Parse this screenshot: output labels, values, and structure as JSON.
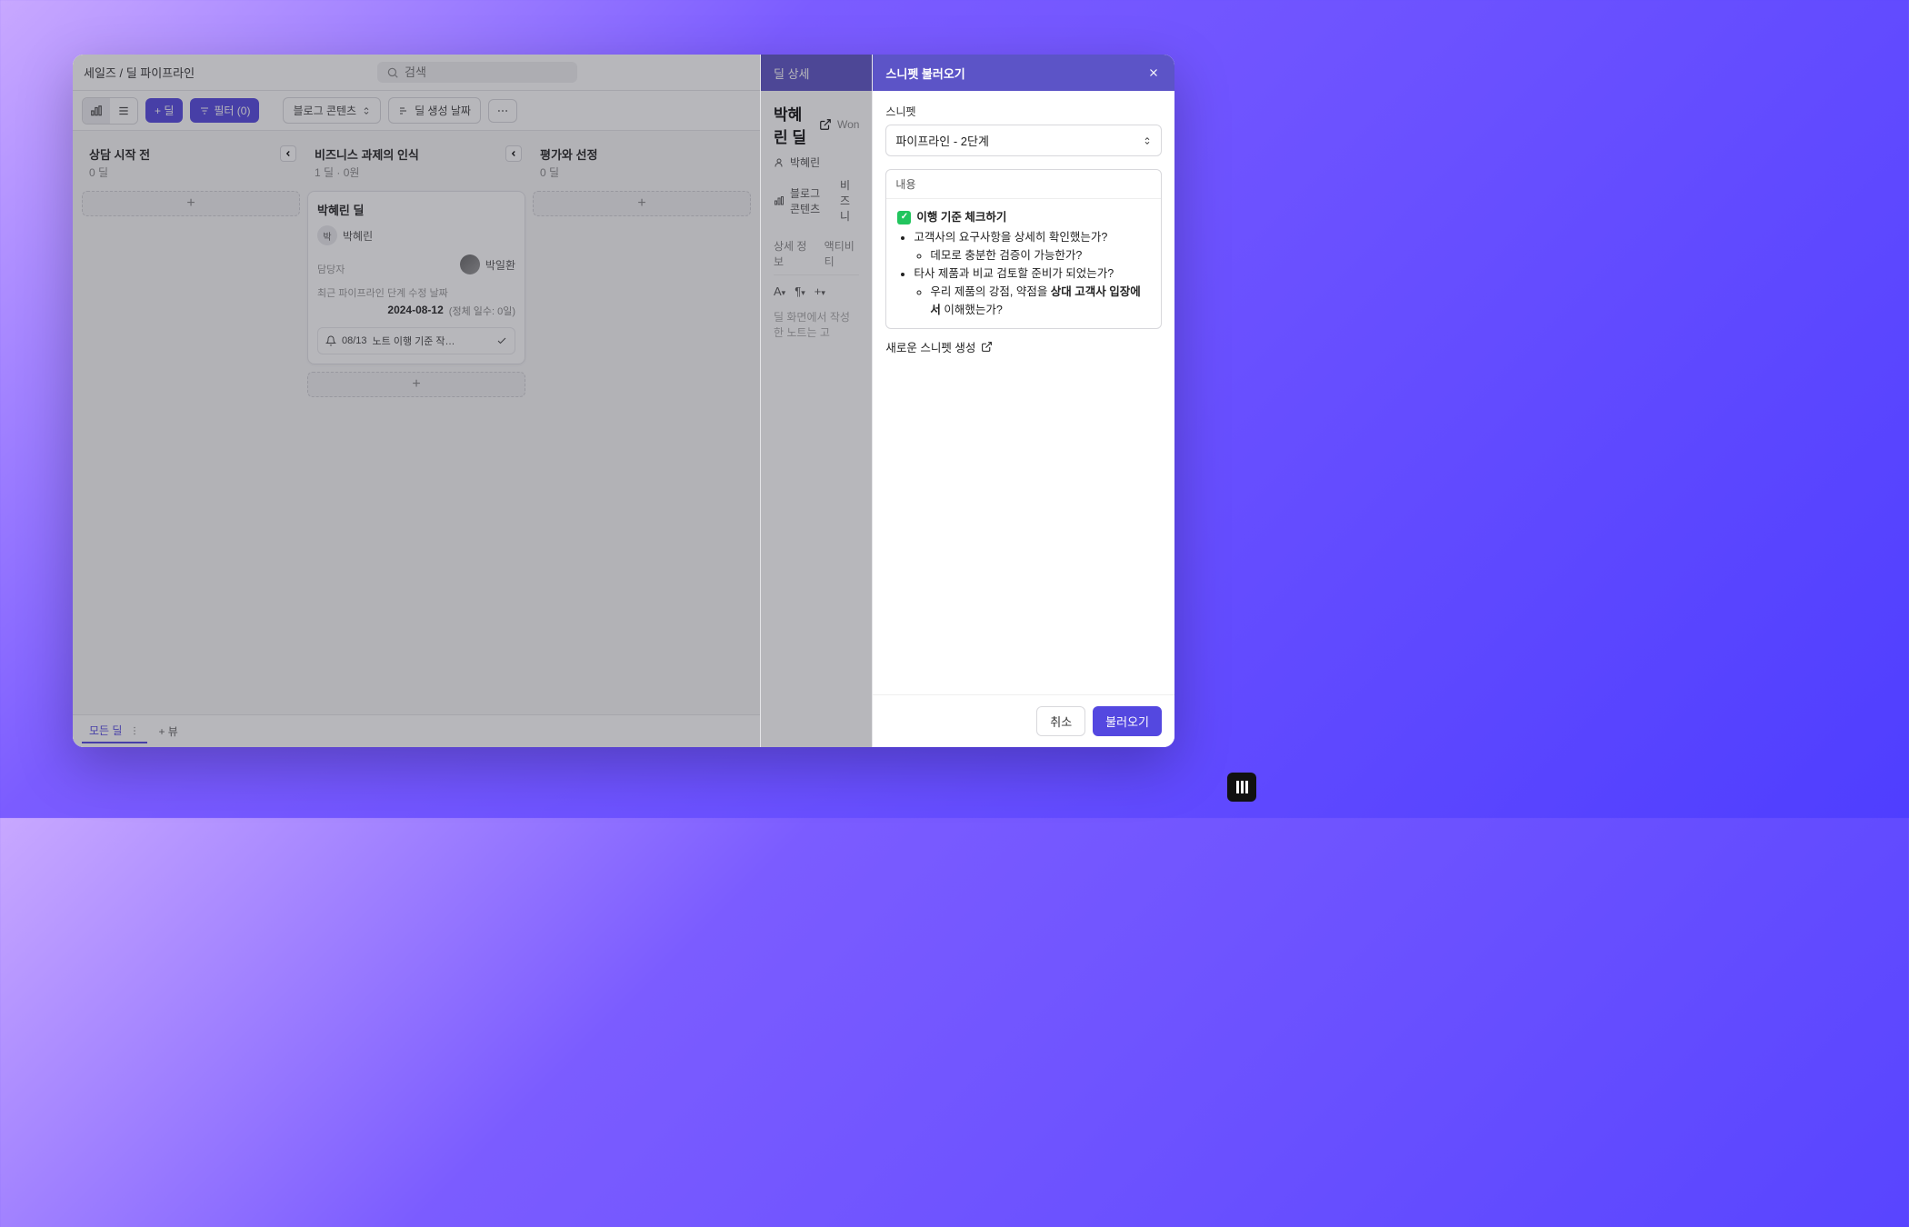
{
  "breadcrumb": "세일즈 / 딜 파이프라인",
  "search": {
    "placeholder": "검색"
  },
  "toolbar": {
    "add_deal": "+ 딜",
    "filter": "필터 (0)",
    "blog_content": "블로그 콘텐츠",
    "sort_label": "딜 생성 날짜"
  },
  "columns": [
    {
      "title": "상담 시작 전",
      "meta": "0 딜"
    },
    {
      "title": "비즈니스 과제의 인식",
      "meta": "1 딜  ·  0원"
    },
    {
      "title": "평가와 선정",
      "meta": "0 딜"
    }
  ],
  "card": {
    "title": "박혜린 딜",
    "contact_chip": "박",
    "contact_name": "박혜린",
    "owner_label": "담당자",
    "owner_name": "박일환",
    "recent_label": "최근 파이프라인 단계 수정 날짜",
    "date": "2024-08-12",
    "stale": "(정체 일수: 0일)",
    "footer_date": "08/13",
    "footer_text": "노트 이행 기준 작…"
  },
  "bottom": {
    "tab": "모든 딜",
    "add_view": "+ 뷰"
  },
  "detail": {
    "header": "딜 상세",
    "title": "박혜린 딜",
    "contact": "박혜린",
    "pipeline_label": "블로그 콘텐츠",
    "stage_label": "비즈니",
    "won_label": "Won",
    "tabs": {
      "info": "상세 정보",
      "activity": "액티비티"
    },
    "hint": "딜 화면에서 작성한 노트는 고"
  },
  "modal": {
    "title": "스니펫 불러오기",
    "field_label": "스니펫",
    "select_value": "파이프라인 - 2단계",
    "content_label": "내용",
    "check_title": "이행 기준 체크하기",
    "items": [
      "고객사의 요구사항을 상세히 확인했는가?",
      "데모로 충분한 검증이 가능한가?",
      "타사 제품과 비교 검토할 준비가 되었는가?",
      "우리 제품의 강점, 약점을 상대 고객사 입장에서 이해했는가?"
    ],
    "item_bold": "상대 고객사 입장에서",
    "new_snippet": "새로운 스니펫 생성",
    "cancel": "취소",
    "submit": "불러오기"
  }
}
